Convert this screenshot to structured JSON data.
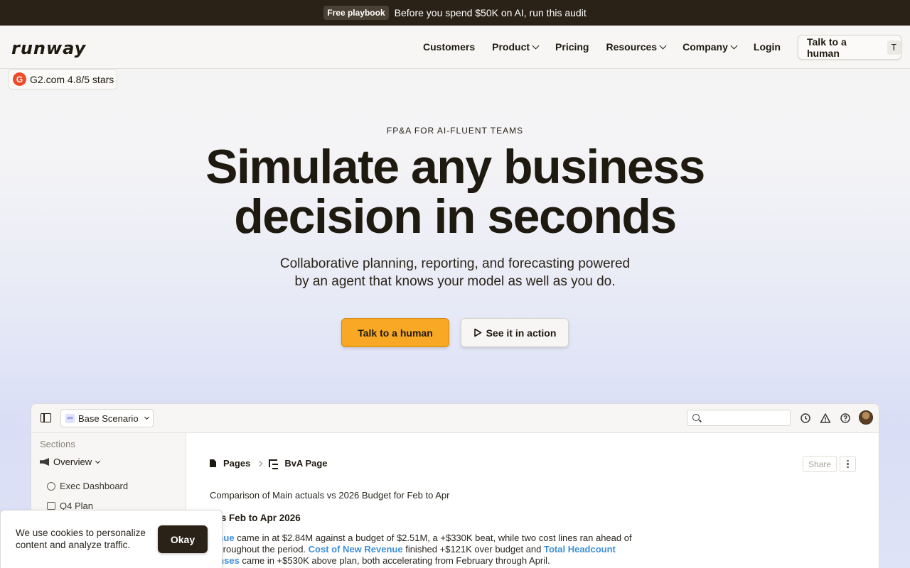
{
  "announcement": {
    "pill": "Free playbook",
    "message": "Before you spend $50K on AI, run this audit"
  },
  "header": {
    "logo": "runway",
    "nav": [
      {
        "label": "Customers",
        "has_dropdown": false
      },
      {
        "label": "Product",
        "has_dropdown": true
      },
      {
        "label": "Pricing",
        "has_dropdown": false
      },
      {
        "label": "Resources",
        "has_dropdown": true
      },
      {
        "label": "Company",
        "has_dropdown": true
      },
      {
        "label": "Login",
        "has_dropdown": false
      }
    ],
    "cta": "Talk to a human",
    "cta_shortcut": "T"
  },
  "badge": {
    "icon": "G",
    "text": "G2.com 4.8/5 stars"
  },
  "hero": {
    "eyebrow": "FP&A FOR AI-FLUENT TEAMS",
    "title_line1": "Simulate any business",
    "title_line2": "decision in seconds",
    "subtitle_line1": "Collaborative planning, reporting, and forecasting powered",
    "subtitle_line2": "by an agent that knows your model as well as you do.",
    "primary_cta": "Talk to a human",
    "secondary_cta": "See it in action"
  },
  "app": {
    "scenario": "Base Scenario",
    "search_placeholder": "",
    "sidebar": {
      "sections_label": "Sections",
      "overview": "Overview",
      "items": [
        "Exec Dashboard",
        "Q4 Plan"
      ]
    },
    "breadcrumbs": [
      "Pages",
      "BvA Page"
    ],
    "share": "Share",
    "doc": {
      "intro": "Comparison of Main actuals vs 2026 Budget for Feb to Apr",
      "heading": "tals Feb to Apr 2026",
      "p1_a": "venue",
      "p1_b": " came in at $2.84M against a budget of $2.51M, a +$330K beat, while two cost lines ran ahead of",
      "p2_a": "n throughout the period. ",
      "p2_b": "Cost of New Revenue",
      "p2_c": " finished +$121K over budget and ",
      "p2_d": "Total Headcount",
      "p3_a": "penses",
      "p3_b": " came in +$530K above plan, both accelerating from February through April."
    }
  },
  "cookie": {
    "text": "We use cookies to personalize content and analyze traffic.",
    "button": "Okay"
  },
  "colors": {
    "primary_cta": "#f9a825",
    "dark": "#2a2217",
    "link": "#3f8fd6",
    "g2": "#ef4b2b"
  }
}
